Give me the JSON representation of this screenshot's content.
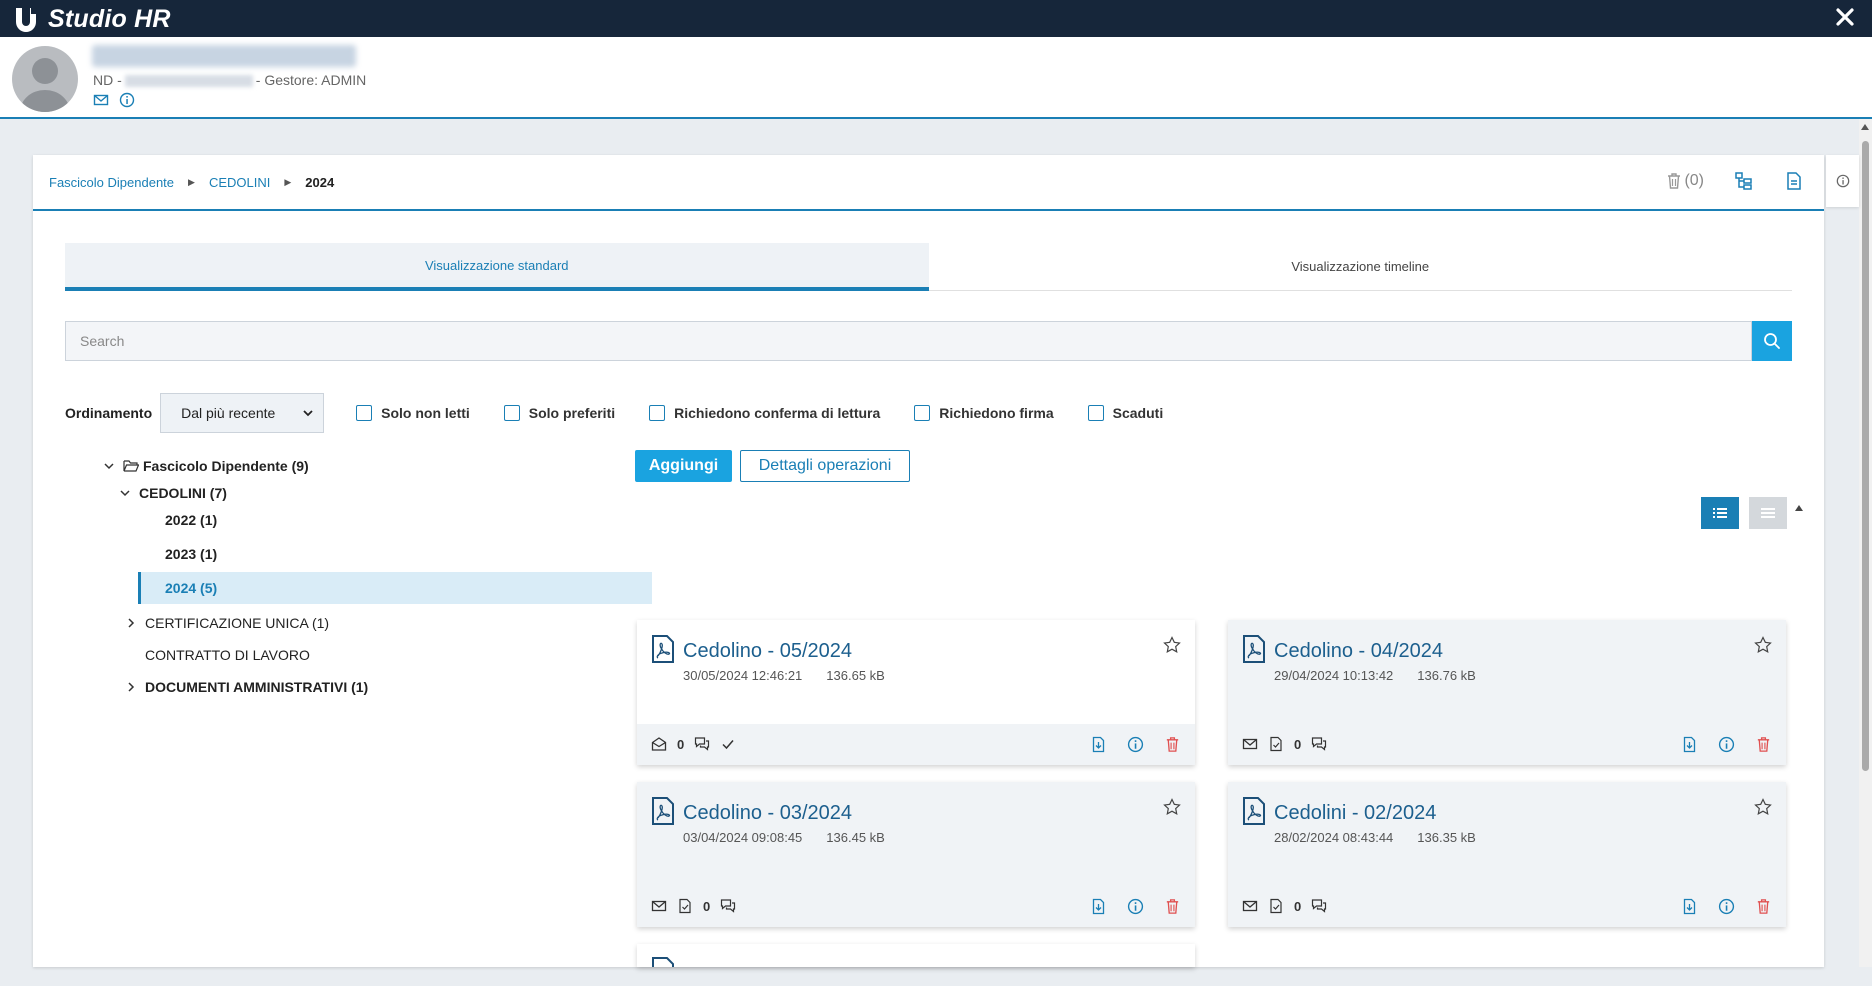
{
  "app": {
    "title": "Studio HR"
  },
  "employee": {
    "sub_prefix": "ND -",
    "sub_manager": "- Gestore: ADMIN"
  },
  "breadcrumb": {
    "items": [
      "Fascicolo Dipendente",
      "CEDOLINI"
    ],
    "current": "2024",
    "trash_count": "(0)"
  },
  "tabs": [
    {
      "label": "Visualizzazione standard",
      "active": true
    },
    {
      "label": "Visualizzazione timeline",
      "active": false
    }
  ],
  "search": {
    "placeholder": "Search"
  },
  "filters": {
    "ordering_label": "Ordinamento",
    "ordering_value": "Dal più recente",
    "checkboxes": [
      {
        "label": "Solo non letti",
        "checked": false
      },
      {
        "label": "Solo preferiti",
        "checked": false
      },
      {
        "label": "Richiedono conferma di lettura",
        "checked": false
      },
      {
        "label": "Richiedono firma",
        "checked": false
      },
      {
        "label": "Scaduti",
        "checked": false
      }
    ]
  },
  "tree": {
    "root": "Fascicolo Dipendente (9)",
    "cedolini": "CEDOLINI (7)",
    "years": [
      "2022 (1)",
      "2023 (1)",
      "2024 (5)"
    ],
    "cert_unica": "CERTIFICAZIONE UNICA (1)",
    "contratto": "CONTRATTO DI LAVORO",
    "documenti": "DOCUMENTI AMMINISTRATIVI (1)"
  },
  "actions": {
    "add": "Aggiungi",
    "details": "Dettagli operazioni"
  },
  "documents": [
    {
      "title": "Cedolino - 05/2024",
      "date": "30/05/2024 12:46:21",
      "size": "136.65 kB",
      "comments": "0",
      "read": true
    },
    {
      "title": "Cedolino - 04/2024",
      "date": "29/04/2024 10:13:42",
      "size": "136.76 kB",
      "comments": "0",
      "read": false
    },
    {
      "title": "Cedolino - 03/2024",
      "date": "03/04/2024 09:08:45",
      "size": "136.45 kB",
      "comments": "0",
      "read": false
    },
    {
      "title": "Cedolini - 02/2024",
      "date": "28/02/2024 08:43:44",
      "size": "136.35 kB",
      "comments": "0",
      "read": false
    }
  ],
  "colors": {
    "titlebar": "#16263a",
    "accent": "#1a7fb5",
    "primary_button": "#1aa3e0",
    "delete": "#e05050"
  }
}
